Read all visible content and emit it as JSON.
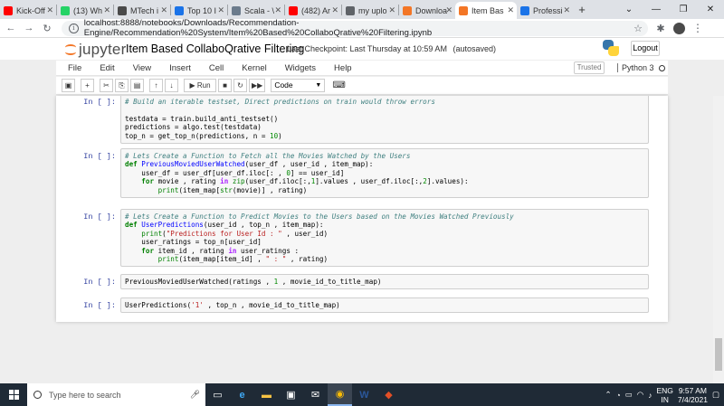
{
  "browser": {
    "tabs": [
      {
        "label": "Kick-Off",
        "color": "#ff0000"
      },
      {
        "label": "(13) Wh",
        "color": "#25d366"
      },
      {
        "label": "MTech i",
        "color": "#4a4a4a"
      },
      {
        "label": "Top 10 I",
        "color": "#1a73e8"
      },
      {
        "label": "Scala - \\",
        "color": "#6b7b8c"
      },
      {
        "label": "(482) Ar",
        "color": "#ff0000"
      },
      {
        "label": "my uplo",
        "color": "#5f6368"
      },
      {
        "label": "Downloa",
        "color": "#f37626"
      },
      {
        "label": "Item Bas",
        "color": "#f37626"
      },
      {
        "label": "Professi",
        "color": "#1a73e8"
      }
    ],
    "active_tab_index": 8,
    "url": "localhost:8888/notebooks/Downloads/Recommendation-Engine/Recommendation%20System/Item%20Based%20CollaboQrative%20Filtering.ipynb"
  },
  "jupyter": {
    "logo_text": "jupyter",
    "notebook_title": "Item Based CollaboQrative Filtering",
    "checkpoint": "Last Checkpoint: Last Thursday at 10:59 AM",
    "autosave": "(autosaved)",
    "logout_label": "Logout",
    "menu": [
      "File",
      "Edit",
      "View",
      "Insert",
      "Cell",
      "Kernel",
      "Widgets",
      "Help"
    ],
    "trusted_label": "Trusted",
    "kernel_name": "Python 3",
    "toolbar": {
      "run_label": "Run",
      "cell_type": "Code"
    }
  },
  "cells": [
    {
      "prompt": "In [ ]:",
      "lines": [
        [
          [
            "c-cm",
            "# Build an iterable testset, Direct predictions on train would throw errors"
          ]
        ],
        [
          [
            "",
            ""
          ]
        ],
        [
          [
            "",
            "testdata = train.build_anti_testset()"
          ]
        ],
        [
          [
            "",
            "predictions = algo.test(testdata)"
          ]
        ],
        [
          [
            "",
            "top_n = get_top_n(predictions, n = "
          ],
          [
            "c-num",
            "10"
          ],
          [
            "",
            ")"
          ]
        ]
      ]
    },
    {
      "prompt": "In [ ]:",
      "lines": [
        [
          [
            "c-cm",
            "# Lets Create a Function to Fetch all the Movies Watched by the Users"
          ]
        ],
        [
          [
            "c-kw",
            "def "
          ],
          [
            "c-fn",
            "PreviousMoviedUserWatched"
          ],
          [
            "",
            "(user_df , user_id , item_map):"
          ]
        ],
        [
          [
            "",
            "    user_df = user_df[user_df.iloc[: , "
          ],
          [
            "c-num",
            "0"
          ],
          [
            "",
            "] == user_id]"
          ]
        ],
        [
          [
            "",
            "    "
          ],
          [
            "c-kw",
            "for"
          ],
          [
            "",
            " movie , rating "
          ],
          [
            "c-op",
            "in"
          ],
          [
            "",
            " "
          ],
          [
            "c-bi",
            "zip"
          ],
          [
            "",
            "(user_df.iloc[:,"
          ],
          [
            "c-num",
            "1"
          ],
          [
            "",
            "].values , user_df.iloc[:,"
          ],
          [
            "c-num",
            "2"
          ],
          [
            "",
            "].values):"
          ]
        ],
        [
          [
            "",
            "        "
          ],
          [
            "c-bi",
            "print"
          ],
          [
            "",
            "(item_map["
          ],
          [
            "c-bi",
            "str"
          ],
          [
            "",
            "(movie)] , rating)"
          ]
        ]
      ]
    },
    {
      "prompt": "In [ ]:",
      "lines": [
        [
          [
            "c-cm",
            "# Lets Create a Function to Predict Movies to the Users based on the Movies Watched Previously"
          ]
        ],
        [
          [
            "c-kw",
            "def "
          ],
          [
            "c-fn",
            "UserPredictions"
          ],
          [
            "",
            "(user_id , top_n , item_map):"
          ]
        ],
        [
          [
            "",
            "    "
          ],
          [
            "c-bi",
            "print"
          ],
          [
            "",
            "("
          ],
          [
            "c-str",
            "\"Predictions for User Id : \""
          ],
          [
            "",
            " , user_id)"
          ]
        ],
        [
          [
            "",
            "    user_ratings = top_n[user_id]"
          ]
        ],
        [
          [
            "",
            "    "
          ],
          [
            "c-kw",
            "for"
          ],
          [
            "",
            " item_id , rating "
          ],
          [
            "c-op",
            "in"
          ],
          [
            "",
            " user_ratings :"
          ]
        ],
        [
          [
            "",
            "        "
          ],
          [
            "c-bi",
            "print"
          ],
          [
            "",
            "(item_map[item_id] , "
          ],
          [
            "c-str",
            "\" : \""
          ],
          [
            "",
            " , rating)"
          ]
        ]
      ]
    },
    {
      "prompt": "In [ ]:",
      "lines": [
        [
          [
            "",
            "PreviousMoviedUserWatched(ratings , "
          ],
          [
            "c-num",
            "1"
          ],
          [
            "",
            " , movie_id_to_title_map)"
          ]
        ]
      ]
    },
    {
      "prompt": "In [ ]:",
      "lines": [
        [
          [
            "",
            "UserPredictions("
          ],
          [
            "c-str",
            "'1'"
          ],
          [
            "",
            " , top_n , movie_id_to_title_map)"
          ]
        ]
      ]
    }
  ],
  "taskbar": {
    "search_placeholder": "Type here to search",
    "language": "ENG",
    "region": "IN",
    "time": "9:57 AM",
    "date": "7/4/2021"
  }
}
